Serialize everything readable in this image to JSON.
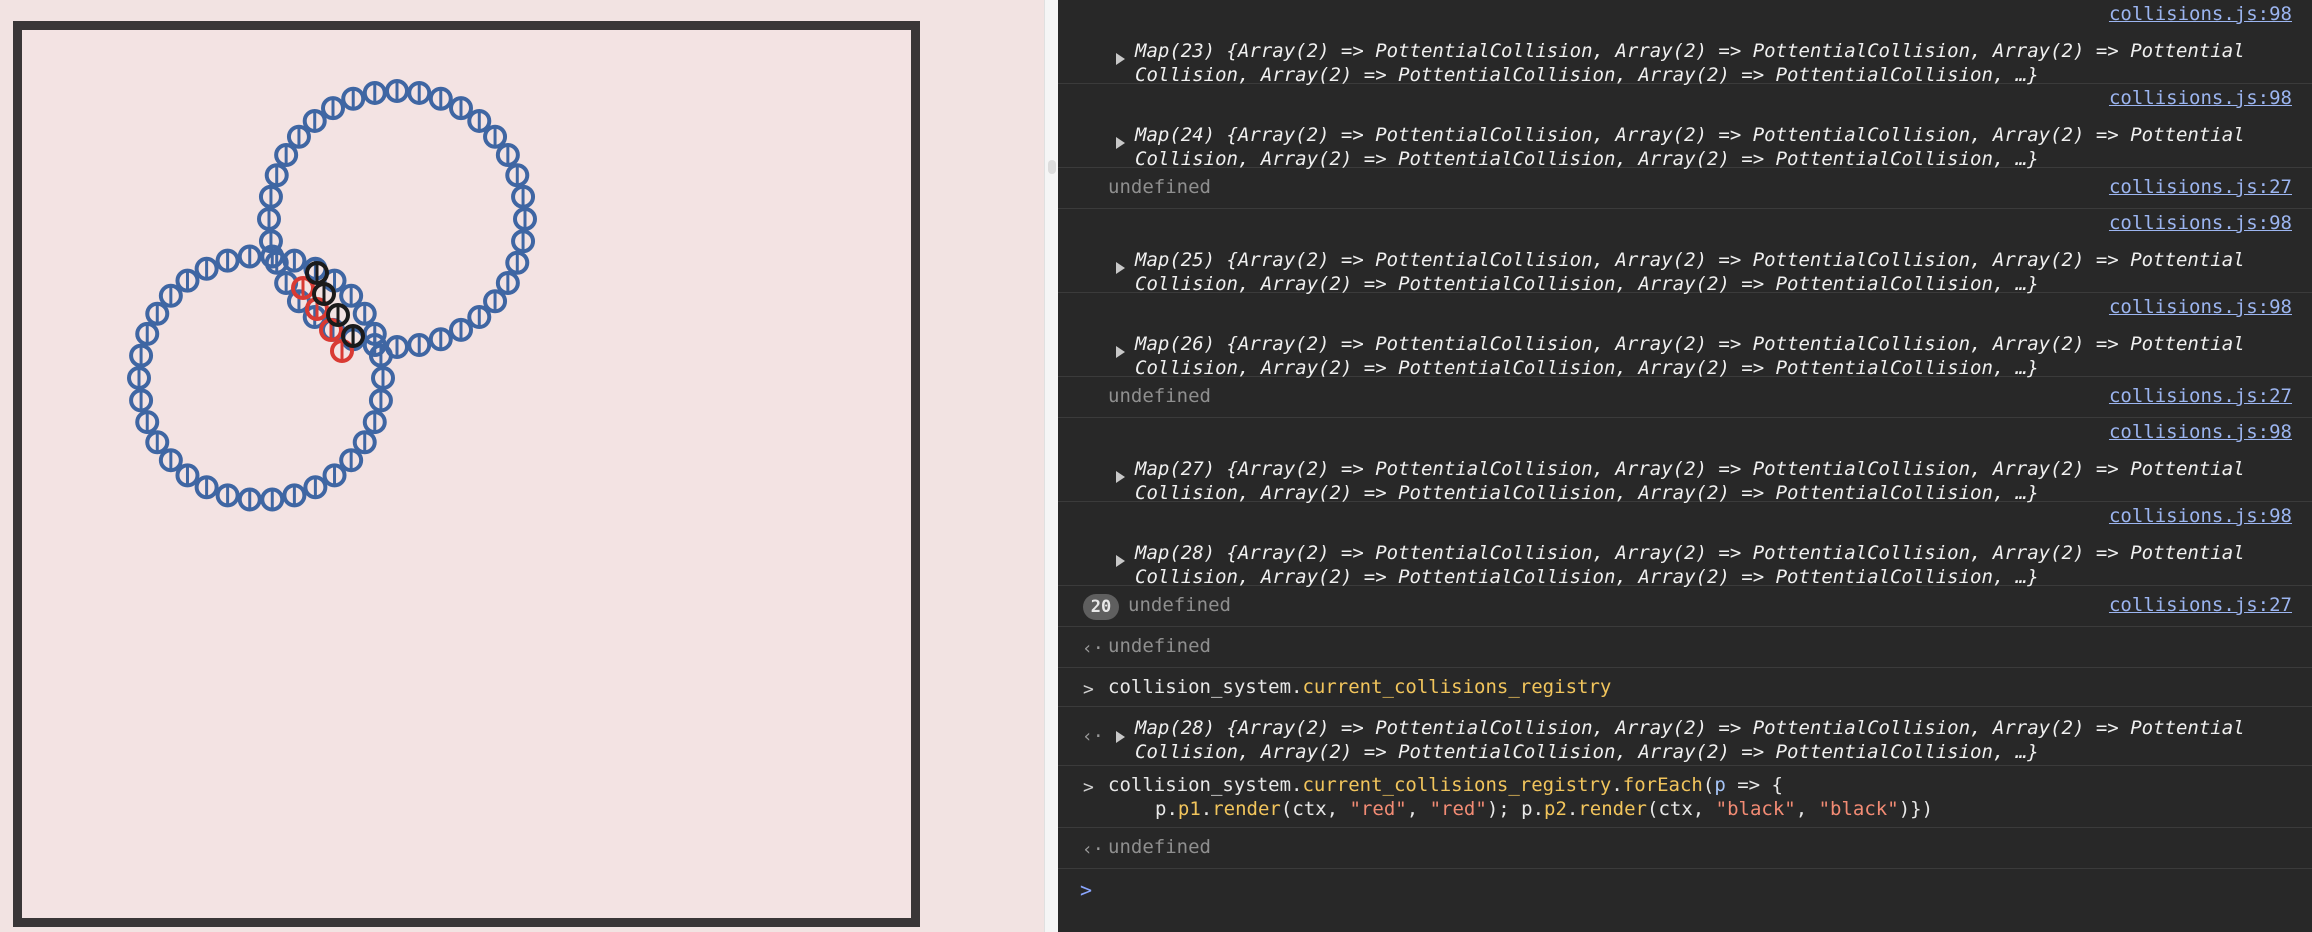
{
  "colors": {
    "page_bg": "#f2e3e2",
    "frame": "#3a3637",
    "particle_default": "#3f66a3",
    "particle_p1": "#d93a33",
    "particle_p2": "#1b1b1b",
    "console_bg": "#282828",
    "link": "#9cb5f0",
    "prop": "#f2c55c",
    "string": "#f28b74"
  },
  "console": {
    "map_line2": "Collision, Array(2) => PottentialCollision, Array(2) => PottentialCollision, …}",
    "entries": [
      {
        "type": "map",
        "source": "collisions.js:98",
        "line1": "Map(23) {Array(2) => PottentialCollision, Array(2) => PottentialCollision, Array(2) => Pottential"
      },
      {
        "type": "map",
        "source": "collisions.js:98",
        "line1": "Map(24) {Array(2) => PottentialCollision, Array(2) => PottentialCollision, Array(2) => Pottential"
      },
      {
        "type": "undefined",
        "source": "collisions.js:27",
        "text": "undefined"
      },
      {
        "type": "map",
        "source": "collisions.js:98",
        "line1": "Map(25) {Array(2) => PottentialCollision, Array(2) => PottentialCollision, Array(2) => Pottential"
      },
      {
        "type": "map",
        "source": "collisions.js:98",
        "line1": "Map(26) {Array(2) => PottentialCollision, Array(2) => PottentialCollision, Array(2) => Pottential"
      },
      {
        "type": "undefined",
        "source": "collisions.js:27",
        "text": "undefined"
      },
      {
        "type": "map",
        "source": "collisions.js:98",
        "line1": "Map(27) {Array(2) => PottentialCollision, Array(2) => PottentialCollision, Array(2) => Pottential"
      },
      {
        "type": "map",
        "source": "collisions.js:98",
        "line1": "Map(28) {Array(2) => PottentialCollision, Array(2) => PottentialCollision, Array(2) => Pottential"
      }
    ],
    "repeat_badge": "20",
    "repeat_text": "undefined",
    "repeat_source": "collisions.js:27",
    "result1": "undefined",
    "cmd1": {
      "obj": "collision_system.",
      "prop": "current_collisions_registry"
    },
    "result_map_line1": "Map(28) {Array(2) => PottentialCollision, Array(2) => PottentialCollision, Array(2) => Pottential",
    "cmd2": {
      "obj": "collision_system.",
      "prop1": "current_collisions_registry",
      "dot": ".",
      "method": "forEach",
      "open": "(",
      "param": "p",
      "arrow": " => {",
      "l2_p": "p.",
      "l2_p1": "p1",
      "l2_dot": ".",
      "l2_render": "render",
      "l2_args_open": "(ctx, ",
      "s_red1": "\"red\"",
      "comma": ", ",
      "s_red2": "\"red\"",
      "sep": "); p.",
      "l2_p2": "p2",
      "l2_dot2": ".",
      "l2_render2": "render",
      "l2_args_open2": "(ctx, ",
      "s_black1": "\"black\"",
      "comma2": ", ",
      "s_black2": "\"black\"",
      "close": ")})"
    },
    "result2": "undefined"
  }
}
